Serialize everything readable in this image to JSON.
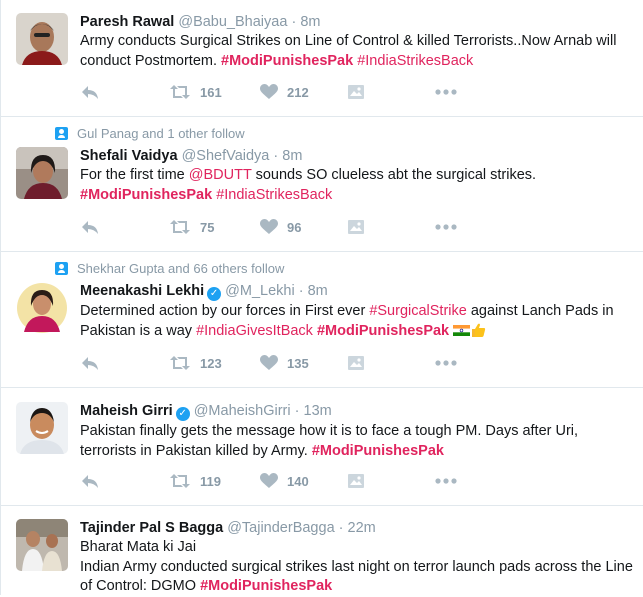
{
  "colors": {
    "accent": "#e0245e",
    "muted": "#8899a6",
    "verified": "#1da1f2",
    "text": "#14171a"
  },
  "icons": {
    "reply": "reply-arrow-icon",
    "retweet": "retweet-icon",
    "like": "heart-icon",
    "media": "image-icon",
    "more": "more-dots-icon",
    "verified": "verified-badge-icon",
    "follow_context": "person-icon"
  },
  "tweets": [
    {
      "name": "Paresh Rawal",
      "handle": "@Babu_Bhaiyaa",
      "dot": "·",
      "time": "8m",
      "text": {
        "plain1": "Army conducts Surgical Strikes on Line of Control & killed Terrorists..Now Arnab will conduct Postmortem. ",
        "tag1": "#ModiPunishesPak",
        "space": " ",
        "tag2": "#IndiaStrikesBack"
      },
      "retweets": "161",
      "likes": "212"
    },
    {
      "context": "Gul Panag and 1 other follow",
      "name": "Shefali Vaidya",
      "handle": "@ShefVaidya",
      "dot": "·",
      "time": "8m",
      "text": {
        "plain1": "For the first time ",
        "mention": "@BDUTT",
        "plain2": " sounds SO clueless abt the surgical strikes.",
        "tag1": "#ModiPunishesPak",
        "space": " ",
        "tag2": "#IndiaStrikesBack"
      },
      "retweets": "75",
      "likes": "96"
    },
    {
      "context": "Shekhar Gupta and 66 others follow",
      "name": "Meenakashi Lekhi",
      "handle": "@M_Lekhi",
      "dot": "·",
      "time": "8m",
      "text": {
        "plain1": "Determined action by our forces in First ever ",
        "tag1": "#SurgicalStrike",
        "plain2": " against Lanch Pads in Pakistan is a way ",
        "tag2": "#IndiaGivesItBack",
        "space": " ",
        "tag3": "#ModiPunishesPak"
      },
      "retweets": "123",
      "likes": "135"
    },
    {
      "name": "Maheish Girri",
      "handle": "@MaheishGirri",
      "dot": "·",
      "time": "13m",
      "text": {
        "plain1": "Pakistan finally gets the message how it is to face a tough PM. Days after Uri, terrorists in Pakistan killed by Army. ",
        "tag1": "#ModiPunishesPak"
      },
      "retweets": "119",
      "likes": "140"
    },
    {
      "name": "Tajinder Pal S Bagga",
      "handle": "@TajinderBagga",
      "dot": "·",
      "time": "22m",
      "text": {
        "line1": "Bharat Mata ki Jai",
        "plain1": "Indian Army conducted surgical strikes last night on terror launch pads across the Line of Control: DGMO ",
        "tag1": "#ModiPunishesPak"
      }
    }
  ]
}
